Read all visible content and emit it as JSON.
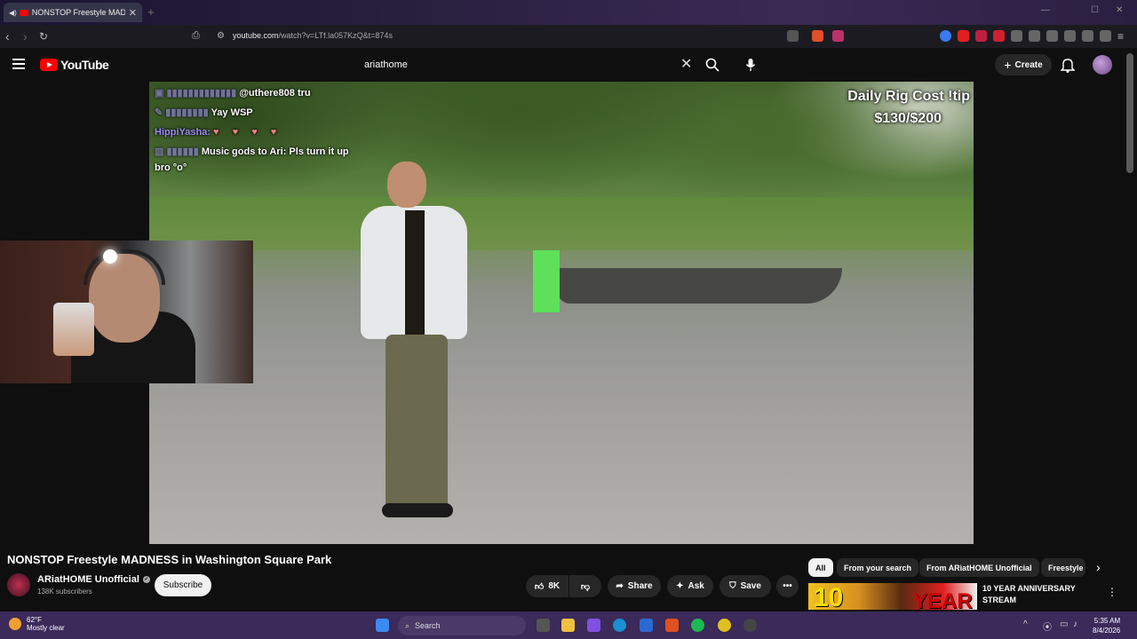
{
  "browser": {
    "tab_title": "NONSTOP Freestyle MADNE",
    "url_domain": "youtube.com",
    "url_path": "/watch?v=LTf.la057KzQ&t=874s"
  },
  "youtube": {
    "logo_text": "YouTube",
    "search_query": "ariathome",
    "create_label": "Create"
  },
  "video": {
    "chat": [
      {
        "user": "@uthere808 tru",
        "msg": ""
      },
      {
        "user": "",
        "msg": "Yay WSP"
      },
      {
        "user": "HippiYasha:",
        "msg": "♥ ♥ ♥ ♥"
      },
      {
        "user": "",
        "msg": "Music gods to Ari: Pls turn it up"
      },
      {
        "user": "",
        "msg": "bro °o°"
      }
    ],
    "overlay_line1": "Daily Rig Cost !tip",
    "overlay_line2": "$130/$200"
  },
  "watch": {
    "title": "NONSTOP Freestyle MADNESS in Washington Square Park",
    "channel_name": "ARiatHOME Unofficial",
    "subscribers": "138K subscribers",
    "subscribe_label": "Subscribe",
    "likes": "8K",
    "share_label": "Share",
    "ask_label": "Ask",
    "save_label": "Save"
  },
  "recs": {
    "chips": [
      "All",
      "From your search",
      "From ARiatHOME Unofficial",
      "Freestyle"
    ],
    "first": {
      "title_line1": "10 YEAR ANNIVERSARY",
      "title_line2": "STREAM",
      "thumb_big": "10",
      "thumb_year": "YEAR"
    }
  },
  "taskbar": {
    "temp": "62°F",
    "weather": "Mostly clear",
    "search": "Search",
    "time": "5:35 AM",
    "date": "8/4/2026"
  }
}
